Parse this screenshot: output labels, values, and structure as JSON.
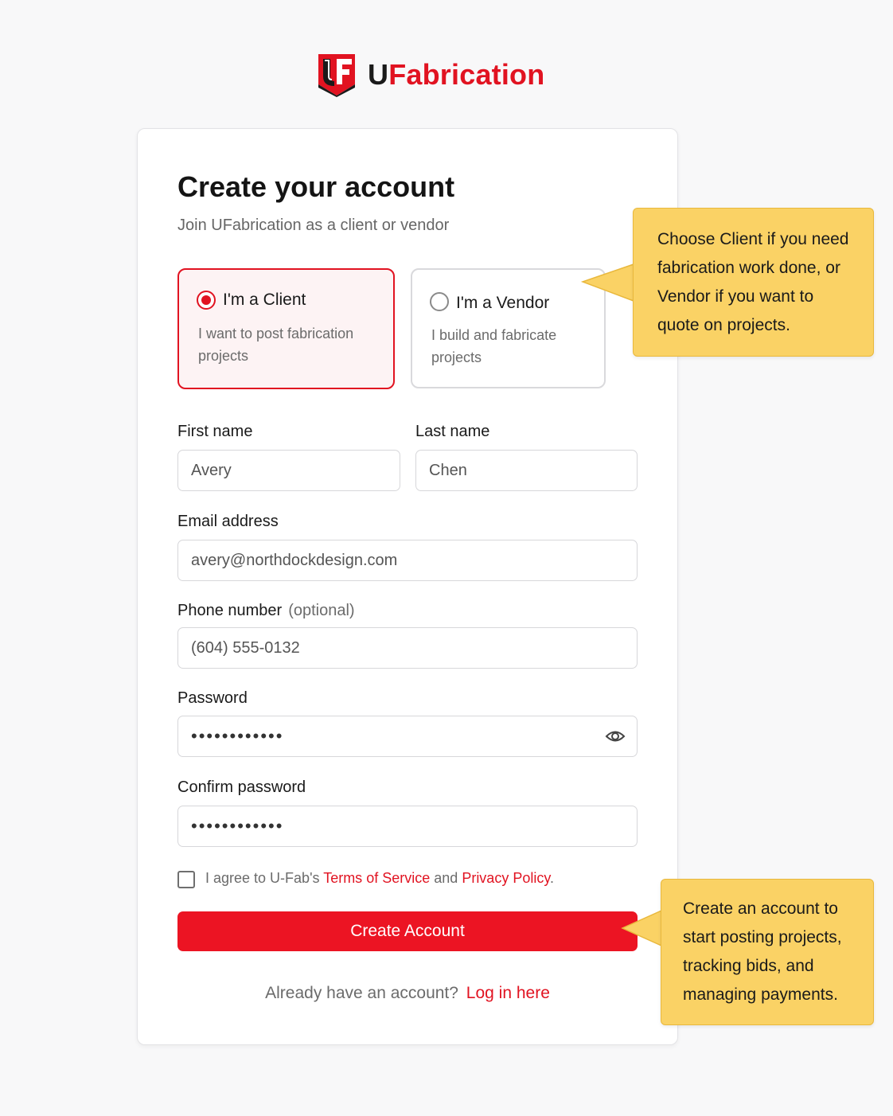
{
  "brand": {
    "logo_icon": "uf-shield-logo-icon",
    "name": "UFabrication",
    "accent_color": "#e11321"
  },
  "form": {
    "title": "Create your account",
    "subtitle": "Join UFabrication as a client or vendor",
    "roles": [
      {
        "title": "I'm a Client",
        "description": "I want to post fabrication projects",
        "selected": true
      },
      {
        "title": "I'm a Vendor",
        "description": "I build and fabricate projects",
        "selected": false
      }
    ],
    "first_name": {
      "label": "First name",
      "value": "Avery"
    },
    "last_name": {
      "label": "Last name",
      "value": "Chen"
    },
    "email": {
      "label": "Email address",
      "value": "avery@northdockdesign.com"
    },
    "phone": {
      "label": "Phone number",
      "optional": "(optional)",
      "value": "(604) 555-0132"
    },
    "password": {
      "label": "Password",
      "value": "••••••••••••",
      "toggle_icon": "eye-icon"
    },
    "confirm_password": {
      "label": "Confirm password",
      "value": "••••••••••••"
    },
    "terms": {
      "prefix": "I agree to U-Fab's",
      "terms_link": "Terms of Service",
      "and": "and",
      "privacy_link": "Privacy Policy",
      "suffix": ".",
      "checked": false
    },
    "submit_label": "Create Account",
    "login_prompt": "Already have an account?",
    "login_link": "Log in here"
  },
  "callouts": [
    {
      "text": "Choose Client if you need fabrication work done, or Vendor if you want to quote on projects."
    },
    {
      "text": "Create an account to start posting projects, tracking bids, and managing payments."
    }
  ]
}
